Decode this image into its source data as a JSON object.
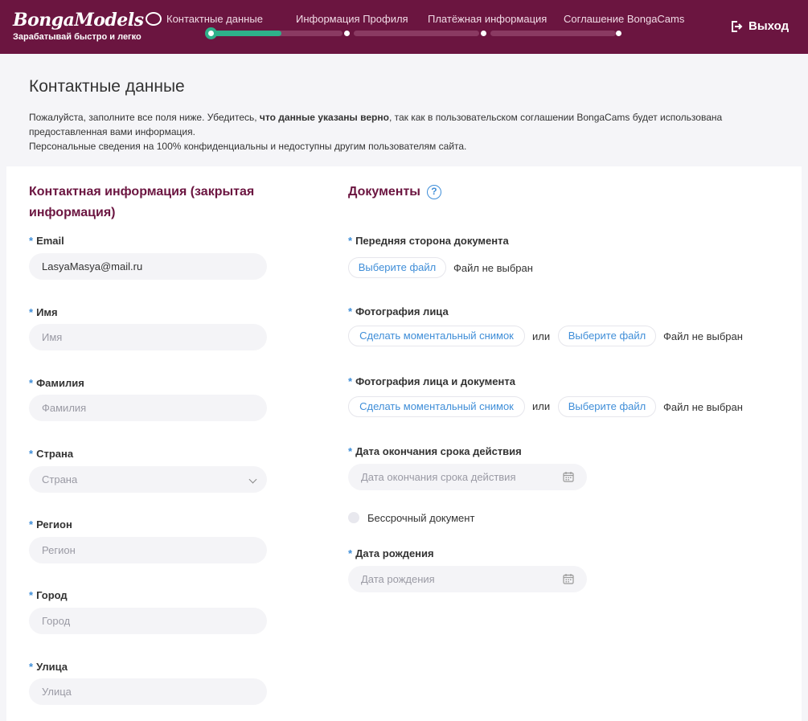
{
  "header": {
    "logo_main": "BongaModels",
    "logo_tagline": "Зарабатывай быстро и легко",
    "steps": [
      {
        "label": "Контактные данные"
      },
      {
        "label": "Информация Профиля"
      },
      {
        "label": "Платёжная информация"
      },
      {
        "label": "Соглашение BongaCams"
      }
    ],
    "logout_label": "Выход"
  },
  "page": {
    "title": "Контактные данные",
    "intro_part1": "Пожалуйста, заполните все поля ниже. Убедитесь, ",
    "intro_bold": "что данные указаны верно",
    "intro_part2": ", так как в пользовательском соглашении BongaCams будет использована предоставленная вами информация.",
    "intro_line2": "Персональные сведения на 100% конфиденциальны и недоступны другим пользователям сайта."
  },
  "contact": {
    "title": "Контактная информация (закрытая информация)",
    "required_mark": "*",
    "fields": [
      {
        "label": "Email",
        "value": "LasyaMasya@mail.ru",
        "placeholder": ""
      },
      {
        "label": "Имя",
        "value": "",
        "placeholder": "Имя"
      },
      {
        "label": "Фамилия",
        "value": "",
        "placeholder": "Фамилия"
      },
      {
        "label": "Страна",
        "value": "",
        "placeholder": "Страна"
      },
      {
        "label": "Регион",
        "value": "",
        "placeholder": "Регион"
      },
      {
        "label": "Город",
        "value": "",
        "placeholder": "Город"
      },
      {
        "label": "Улица",
        "value": "",
        "placeholder": "Улица"
      }
    ]
  },
  "documents": {
    "title": "Документы",
    "help": "?",
    "front_label": "Передняя сторона документа",
    "face_label": "Фотография лица",
    "face_doc_label": "Фотография лица и документа",
    "choose_file": "Выберите файл",
    "no_file": "Файл не выбран",
    "snapshot": "Сделать моментальный снимок",
    "or": "или",
    "expiry_label": "Дата окончания срока действия",
    "expiry_placeholder": "Дата окончания срока действия",
    "indefinite_label": "Бессрочный документ",
    "birth_label": "Дата рождения",
    "birth_placeholder": "Дата рождения"
  },
  "colors": {
    "header_bg": "#6b1540",
    "progress_fill": "#2eb08a",
    "accent_blue": "#3f8ed8"
  }
}
